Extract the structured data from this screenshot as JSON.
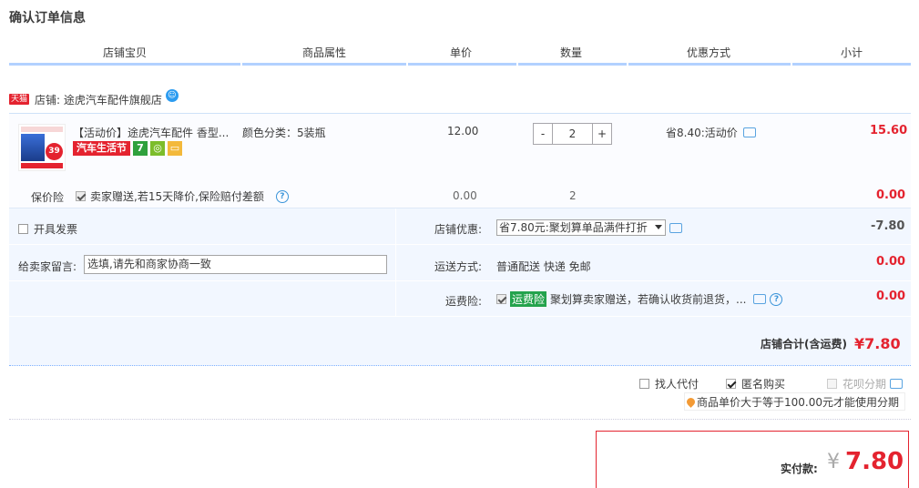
{
  "page": {
    "title": "确认订单信息"
  },
  "table_headers": [
    "店铺宝贝",
    "商品属性",
    "单价",
    "数量",
    "优惠方式",
    "小计"
  ],
  "shop": {
    "badge": "天猫",
    "label": "店铺: 途虎汽车配件旗舰店"
  },
  "item": {
    "title": "【活动价】途虎汽车配件 香型...",
    "attribute": "颜色分类：5装瓶",
    "unit_price": "12.00",
    "quantity": "2",
    "minus": "-",
    "plus": "+",
    "discount": "省8.40:活动价",
    "subtotal": "15.60",
    "promo_badge": "汽车生活节",
    "badge_7": "7",
    "thumb_price": "39"
  },
  "insurance": {
    "label": "保价险",
    "desc": "卖家赠送,若15天降价,保险赔付差额",
    "price": "0.00",
    "qty": "2",
    "subtotal": "0.00"
  },
  "invoice": {
    "label": "开具发票"
  },
  "seller_msg": {
    "label": "给卖家留言:",
    "placeholder": "选填,请先和商家协商一致"
  },
  "shop_discount": {
    "label": "店铺优惠:",
    "selected": "省7.80元:聚划算单品满件打折",
    "value": "-7.80"
  },
  "shipping": {
    "label": "运送方式:",
    "value": "普通配送 快递 免邮",
    "price": "0.00"
  },
  "freight_insurance": {
    "label": "运费险:",
    "tag": "运费险",
    "desc": "聚划算卖家赠送，若确认收货前退货，...",
    "price": "0.00"
  },
  "shop_total": {
    "label": "店铺合计(含运费)",
    "value": "¥7.80"
  },
  "options": {
    "proxy_pay": "找人代付",
    "anonymous": "匿名购买",
    "huabei": "花呗分期",
    "huabei_note": "商品单价大于等于100.00元才能使用分期"
  },
  "payment": {
    "label": "实付款:",
    "currency": "¥",
    "amount": "7.80"
  },
  "colors": {
    "accent_red": "#e4232f",
    "header_blue": "#b2d1ff",
    "panel_bg": "#f2f7ff"
  }
}
